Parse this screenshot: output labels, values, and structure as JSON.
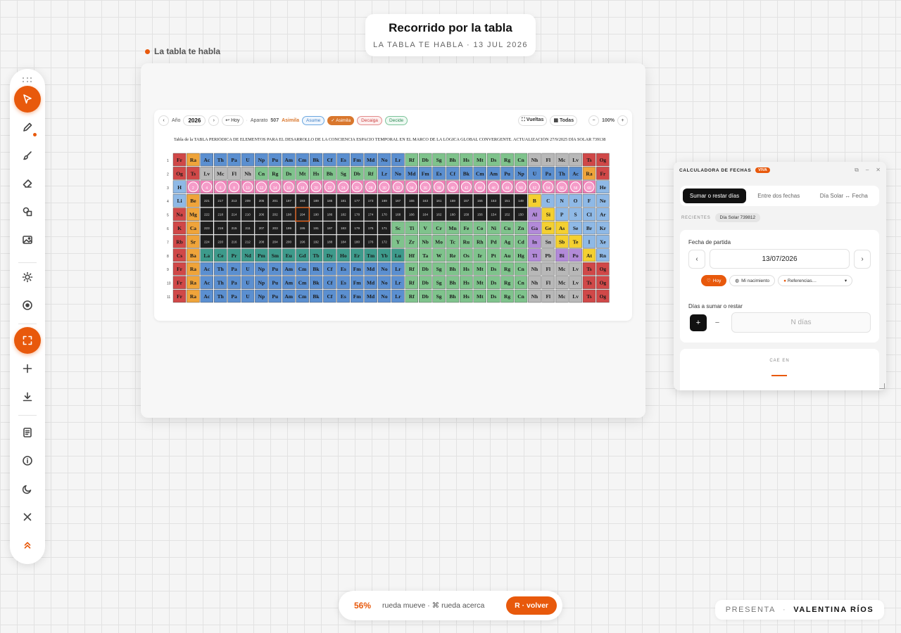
{
  "header": {
    "title": "Recorrido por la tabla",
    "subtitle": "LA TABLA TE HABLA · 13 JUL 2026"
  },
  "frame": {
    "label": "La tabla te habla"
  },
  "document": {
    "toolbar": {
      "prev": "‹",
      "year_label": "Año",
      "year": "2026",
      "next": "›",
      "today": "↩ Hoy",
      "aparato_label": "Aparato",
      "aparato_value": "507",
      "mode_label": "Asimila",
      "pill_asume": "Asume",
      "pill_asimila": "✓ Asimila",
      "pill_decaiga": "Decaiga",
      "pill_decide": "Decide",
      "vueltas": "⛶ Vueltas",
      "todas": "▦ Todas",
      "zoom_out": "−",
      "zoom": "100%",
      "zoom_in": "+"
    },
    "heading": "Tabla de la TABLA PERIÓDICA DE ELEMENTOS PARA EL DESARROLLO DE LA CONCIENCIA ESPACIO TEMPORAL EN EL MARCO DE LA LÓGICA GLOBAL CONVERGENTE. ACTUALIZACIÓN 27/9/2025 DÍA SOLAR 739138",
    "table_rows": [
      [
        "Fr",
        "Ra",
        "Ac",
        "Th",
        "Pa",
        "U",
        "Np",
        "Pu",
        "Am",
        "Cm",
        "Bk",
        "Cf",
        "Es",
        "Fm",
        "Md",
        "No",
        "Lr",
        "Rf",
        "Db",
        "Sg",
        "Bh",
        "Hs",
        "Mt",
        "Ds",
        "Rg",
        "Cn",
        "Nh",
        "Fl",
        "Mc",
        "Lv",
        "Ts",
        "Og"
      ],
      [
        "Og",
        "Ts",
        "Lv",
        "Mc",
        "Fl",
        "Nh",
        "Cn",
        "Rg",
        "Ds",
        "Mt",
        "Hs",
        "Bh",
        "Sg",
        "Db",
        "Rf",
        "Lr",
        "No",
        "Md",
        "Fm",
        "Es",
        "Cf",
        "Bk",
        "Cm",
        "Am",
        "Pu",
        "Np",
        "U",
        "Pa",
        "Th",
        "Ac",
        "Ra",
        "Fr"
      ],
      [
        "H",
        "",
        "",
        "",
        "",
        "",
        "",
        "",
        "",
        "",
        "",
        "",
        "",
        "",
        "",
        "",
        "",
        "",
        "",
        "",
        "",
        "",
        "",
        "",
        "",
        "",
        "",
        "",
        "",
        "",
        "",
        "He"
      ],
      [
        "Li",
        "Be",
        "",
        "",
        "",
        "",
        "",
        "",
        "",
        "",
        "",
        "",
        "",
        "",
        "",
        "",
        "",
        "",
        "",
        "",
        "",
        "",
        "",
        "",
        "",
        "",
        "B",
        "C",
        "N",
        "O",
        "F",
        "Ne"
      ],
      [
        "Na",
        "Mg",
        "",
        "",
        "",
        "",
        "",
        "",
        "",
        "",
        "",
        "",
        "",
        "",
        "",
        "",
        "",
        "",
        "",
        "",
        "",
        "",
        "",
        "",
        "",
        "",
        "Al",
        "Si",
        "P",
        "S",
        "Cl",
        "Ar"
      ],
      [
        "K",
        "Ca",
        "",
        "",
        "",
        "",
        "",
        "",
        "",
        "",
        "",
        "",
        "",
        "",
        "",
        "",
        "Sc",
        "Ti",
        "V",
        "Cr",
        "Mn",
        "Fe",
        "Co",
        "Ni",
        "Cu",
        "Zn",
        "Ga",
        "Ge",
        "As",
        "Se",
        "Br",
        "Kr"
      ],
      [
        "Rb",
        "Sr",
        "",
        "",
        "",
        "",
        "",
        "",
        "",
        "",
        "",
        "",
        "",
        "",
        "",
        "",
        "Y",
        "Zr",
        "Nb",
        "Mo",
        "Tc",
        "Ru",
        "Rh",
        "Pd",
        "Ag",
        "Cd",
        "In",
        "Sn",
        "Sb",
        "Te",
        "I",
        "Xe"
      ],
      [
        "Cs",
        "Ba",
        "La",
        "Ce",
        "Pr",
        "Nd",
        "Pm",
        "Sm",
        "Eu",
        "Gd",
        "Tb",
        "Dy",
        "Ho",
        "Er",
        "Tm",
        "Yb",
        "Lu",
        "Hf",
        "Ta",
        "W",
        "Re",
        "Os",
        "Ir",
        "Pt",
        "Au",
        "Hg",
        "Tl",
        "Pb",
        "Bi",
        "Po",
        "At",
        "Rn"
      ],
      [
        "Fr",
        "Ra",
        "Ac",
        "Th",
        "Pa",
        "U",
        "Np",
        "Pu",
        "Am",
        "Cm",
        "Bk",
        "Cf",
        "Es",
        "Fm",
        "Md",
        "No",
        "Lr",
        "Rf",
        "Db",
        "Sg",
        "Bh",
        "Hs",
        "Mt",
        "Ds",
        "Rg",
        "Cn",
        "Nh",
        "Fl",
        "Mc",
        "Lv",
        "Ts",
        "Og"
      ],
      [
        "Fr",
        "Ra",
        "Ac",
        "Th",
        "Pa",
        "U",
        "Np",
        "Pu",
        "Am",
        "Cm",
        "Bk",
        "Cf",
        "Es",
        "Fm",
        "Md",
        "No",
        "Lr",
        "Rf",
        "Db",
        "Sg",
        "Bh",
        "Hs",
        "Mt",
        "Ds",
        "Rg",
        "Cn",
        "Nh",
        "Fl",
        "Mc",
        "Lv",
        "Ts",
        "Og"
      ],
      [
        "Fr",
        "Ra",
        "Ac",
        "Th",
        "Pa",
        "U",
        "Np",
        "Pu",
        "Am",
        "Cm",
        "Bk",
        "Cf",
        "Es",
        "Fm",
        "Md",
        "No",
        "Lr",
        "Rf",
        "Db",
        "Sg",
        "Bh",
        "Hs",
        "Mt",
        "Ds",
        "Rg",
        "Cn",
        "Nh",
        "Fl",
        "Mc",
        "Lv",
        "Ts",
        "Og"
      ]
    ],
    "dark_row_numbers": [
      [
        "221",
        "217",
        "213",
        "209",
        "205",
        "201",
        "197",
        "193",
        "189",
        "185",
        "181",
        "177",
        "173",
        "169"
      ],
      [
        "222",
        "218",
        "214",
        "210",
        "206",
        "202",
        "198",
        "194",
        "190",
        "186",
        "182",
        "178",
        "174",
        "170"
      ],
      [
        "223",
        "219",
        "215",
        "211",
        "207",
        "203",
        "199",
        "195",
        "191",
        "187",
        "183",
        "179",
        "175",
        "171"
      ],
      [
        "224",
        "220",
        "216",
        "212",
        "208",
        "204",
        "200",
        "196",
        "192",
        "188",
        "184",
        "180",
        "176",
        "172"
      ]
    ],
    "dark_row_numbers_right": [
      [
        "167",
        "165",
        "163",
        "161",
        "159",
        "157",
        "155",
        "153",
        "151",
        "149"
      ],
      [
        "168",
        "166",
        "164",
        "162",
        "160",
        "158",
        "156",
        "154",
        "152",
        "150"
      ]
    ],
    "pink_row_numbers": [
      "2",
      "4",
      "6",
      "8",
      "10",
      "12",
      "14",
      "16",
      "18",
      "20",
      "22",
      "24",
      "26",
      "28",
      "30",
      "32",
      "34",
      "36",
      "38",
      "40",
      "42",
      "44",
      "46",
      "48",
      "50",
      "52",
      "54",
      "56",
      "58",
      "60"
    ]
  },
  "calculator": {
    "title": "CALCULADORA DE FECHAS",
    "badge": "VIVA",
    "tabs": [
      "Sumar o restar días",
      "Entre dos fechas",
      "Día Solar ↔ Fecha"
    ],
    "recientes_label": "RECIENTES",
    "recientes_chip": "Día Solar 739812",
    "start_label": "Fecha de partida",
    "start_date": "13/07/2026",
    "prev": "‹",
    "next": "›",
    "quick_today": "Hoy",
    "quick_birth": "Mi nacimiento",
    "quick_refs": "Referencias…",
    "days_label": "Días a sumar o restar",
    "plus": "+",
    "minus": "−",
    "n_placeholder": "N días",
    "result_label": "CAE EN"
  },
  "status": {
    "zoom": "56%",
    "hint": "rueda mueve · ⌘ rueda acerca",
    "back": "R · volver"
  },
  "presenter": {
    "label": "PRESENTA",
    "separator": "·",
    "name": "VALENTINA RÍOS"
  },
  "colors": {
    "accent": "#e8590c",
    "red": "#d04848",
    "orange": "#efa43a",
    "blue": "#5b8fd0",
    "lightblue": "#8fb9e6",
    "green": "#7fc38c",
    "gray": "#b8b8b8",
    "pink": "#ee7fb6",
    "purple": "#b28ad8",
    "yellow": "#f4d031",
    "teal": "#3d9a8b",
    "dark": "#1e1e1e"
  }
}
